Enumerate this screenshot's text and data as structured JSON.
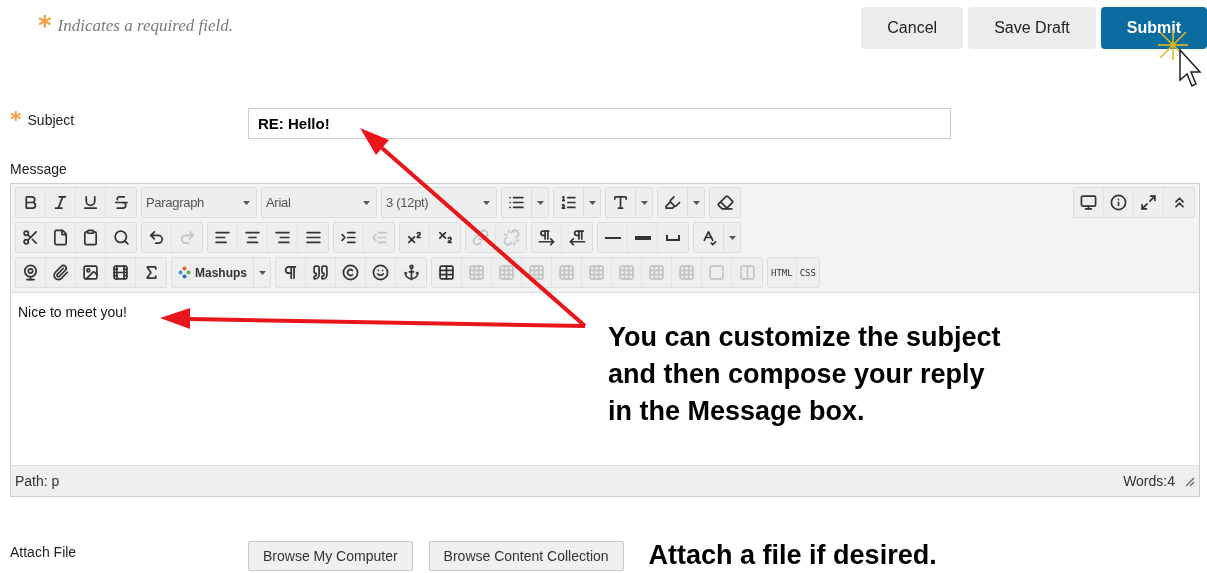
{
  "required_note": {
    "marker": "*",
    "text": "Indicates a required field."
  },
  "actions": [
    {
      "label": "Cancel",
      "kind": "plain"
    },
    {
      "label": "Save Draft",
      "kind": "plain"
    },
    {
      "label": "Submit",
      "kind": "primary"
    }
  ],
  "subject": {
    "marker": "*",
    "label": "Subject",
    "value": "RE: Hello!"
  },
  "message": {
    "label": "Message",
    "toolbar": [
      {
        "groups": [
          {
            "items": [
              {
                "kind": "icon",
                "disabled": false
              },
              {
                "kind": "icon",
                "disabled": false
              },
              {
                "kind": "icon",
                "disabled": false
              },
              {
                "kind": "icon",
                "disabled": false
              }
            ]
          },
          {
            "items": [
              {
                "kind": "select",
                "value": "Paragraph"
              }
            ]
          },
          {
            "items": [
              {
                "kind": "select",
                "value": "Arial"
              }
            ]
          },
          {
            "items": [
              {
                "kind": "select",
                "value": "3 (12pt)"
              }
            ]
          },
          {
            "items": [
              {
                "kind": "split"
              }
            ]
          },
          {
            "items": [
              {
                "kind": "split"
              }
            ]
          },
          {
            "items": [
              {
                "kind": "split"
              }
            ]
          },
          {
            "items": [
              {
                "kind": "split"
              }
            ]
          },
          {
            "items": [
              {
                "kind": "icon",
                "disabled": false
              }
            ]
          }
        ],
        "end_groups": [
          {
            "items": [
              {
                "kind": "icon",
                "disabled": false
              },
              {
                "kind": "icon",
                "disabled": false
              },
              {
                "kind": "icon",
                "disabled": false
              },
              {
                "kind": "icon",
                "disabled": false
              }
            ]
          }
        ]
      },
      {
        "groups": [
          {
            "items": [
              {
                "kind": "icon",
                "disabled": false
              },
              {
                "kind": "icon",
                "disabled": false
              },
              {
                "kind": "icon",
                "disabled": false
              },
              {
                "kind": "icon",
                "disabled": false
              }
            ]
          },
          {
            "items": [
              {
                "kind": "icon",
                "disabled": false
              },
              {
                "kind": "icon",
                "disabled": true
              }
            ]
          },
          {
            "items": [
              {
                "kind": "icon",
                "disabled": false
              },
              {
                "kind": "icon",
                "disabled": false
              },
              {
                "kind": "icon",
                "disabled": false
              },
              {
                "kind": "icon",
                "disabled": false
              }
            ]
          },
          {
            "items": [
              {
                "kind": "icon",
                "disabled": false
              },
              {
                "kind": "icon",
                "disabled": true
              }
            ]
          },
          {
            "items": [
              {
                "kind": "icon",
                "disabled": false
              },
              {
                "kind": "icon",
                "disabled": false
              }
            ]
          },
          {
            "items": [
              {
                "kind": "icon",
                "disabled": true
              },
              {
                "kind": "icon",
                "disabled": true
              }
            ]
          },
          {
            "items": [
              {
                "kind": "icon",
                "disabled": false
              },
              {
                "kind": "icon",
                "disabled": false
              }
            ]
          },
          {
            "items": [
              {
                "kind": "icon",
                "disabled": false
              },
              {
                "kind": "icon",
                "disabled": false
              },
              {
                "kind": "icon",
                "disabled": false
              }
            ]
          },
          {
            "items": [
              {
                "kind": "split"
              }
            ]
          }
        ]
      },
      {
        "groups": [
          {
            "items": [
              {
                "kind": "icon",
                "disabled": false
              },
              {
                "kind": "icon",
                "disabled": false
              },
              {
                "kind": "icon",
                "disabled": false
              },
              {
                "kind": "icon",
                "disabled": false
              },
              {
                "kind": "icon",
                "disabled": false
              }
            ]
          },
          {
            "items": [
              {
                "kind": "split",
                "label": "Mashups"
              }
            ]
          },
          {
            "items": [
              {
                "kind": "icon",
                "disabled": false
              },
              {
                "kind": "icon",
                "disabled": false
              },
              {
                "kind": "icon",
                "disabled": false
              },
              {
                "kind": "icon",
                "disabled": false
              },
              {
                "kind": "icon",
                "disabled": false
              }
            ]
          },
          {
            "items": [
              {
                "kind": "icon",
                "disabled": false
              },
              {
                "kind": "icon",
                "disabled": true
              },
              {
                "kind": "icon",
                "disabled": true
              },
              {
                "kind": "icon",
                "disabled": true
              },
              {
                "kind": "icon",
                "disabled": true
              },
              {
                "kind": "icon",
                "disabled": true
              },
              {
                "kind": "icon",
                "disabled": true
              },
              {
                "kind": "icon",
                "disabled": true
              },
              {
                "kind": "icon",
                "disabled": true
              },
              {
                "kind": "icon",
                "disabled": true
              },
              {
                "kind": "icon",
                "disabled": true
              }
            ]
          },
          {
            "items": [
              {
                "kind": "text",
                "label": "HTML"
              },
              {
                "kind": "text",
                "label": "CSS"
              }
            ]
          }
        ]
      }
    ],
    "body": "Nice to meet you!",
    "path": "Path: p",
    "word_count": "Words:4"
  },
  "attach": {
    "label": "Attach File",
    "buttons": [
      "Browse My Computer",
      "Browse Content Collection"
    ]
  },
  "annotations": [
    {
      "kind": "callout",
      "lines": [
        "You can customize the subject",
        "and then compose your reply",
        "in the Message box."
      ]
    },
    {
      "kind": "note",
      "text": "Attach a file if desired."
    }
  ]
}
